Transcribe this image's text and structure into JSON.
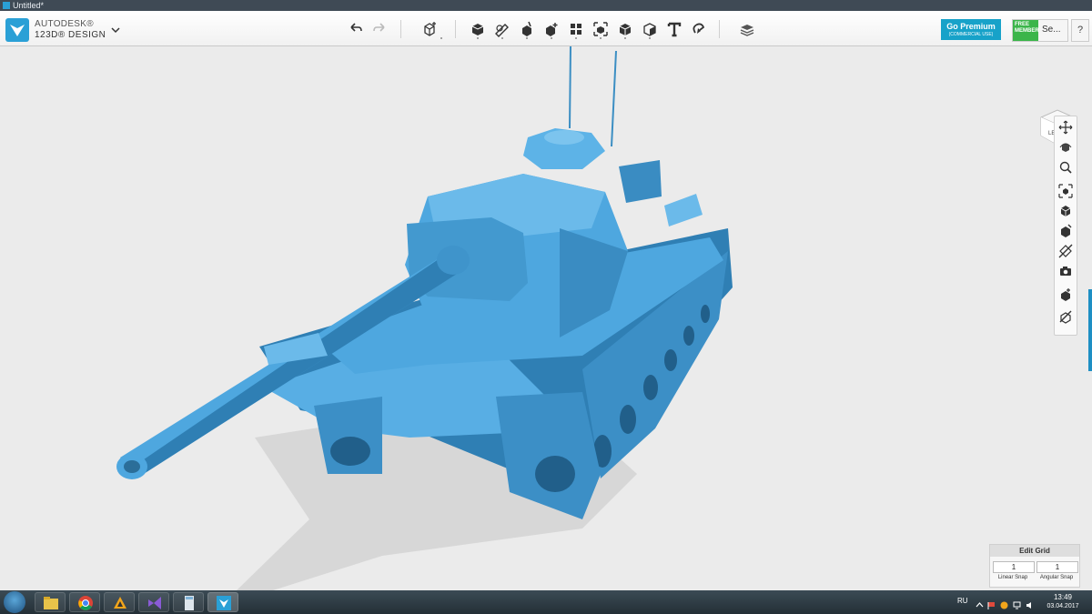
{
  "window": {
    "title": "Untitled*"
  },
  "brand": {
    "line1": "AUTODESK®",
    "line2": "123D® DESIGN"
  },
  "toolbar": {
    "undo_icon": "undo-icon",
    "redo_icon": "redo-icon",
    "tools": [
      "transform-icon",
      "primitives-icon",
      "sketch-icon",
      "construct-icon",
      "modify-icon",
      "pattern-icon",
      "grouping-icon",
      "combine-icon",
      "measure-icon",
      "text-icon",
      "snap-icon",
      "materials-icon"
    ]
  },
  "premium": {
    "label": "Go Premium",
    "sub": "(COMMERCIAL USE)"
  },
  "member": {
    "badge": "FREE MEMBER",
    "label": "Se..."
  },
  "help": {
    "label": "?"
  },
  "viewcube": {
    "face": "LEFT"
  },
  "edit_grid": {
    "title": "Edit Grid",
    "linear_snap_value": "1",
    "angular_snap_value": "1",
    "linear_snap_label": "Linear Snap",
    "angular_snap_label": "Angular Snap"
  },
  "taskbar": {
    "apps": [
      "file-explorer-icon",
      "chrome-icon",
      "app-triangle-icon",
      "visual-studio-icon",
      "calculator-icon",
      "123d-design-icon"
    ],
    "language": "RU",
    "time": "13:49",
    "date": "03.04.2017"
  },
  "colors": {
    "model": "#4ea7df",
    "model_dark": "#2b6e99",
    "accent": "#17a2c9"
  }
}
